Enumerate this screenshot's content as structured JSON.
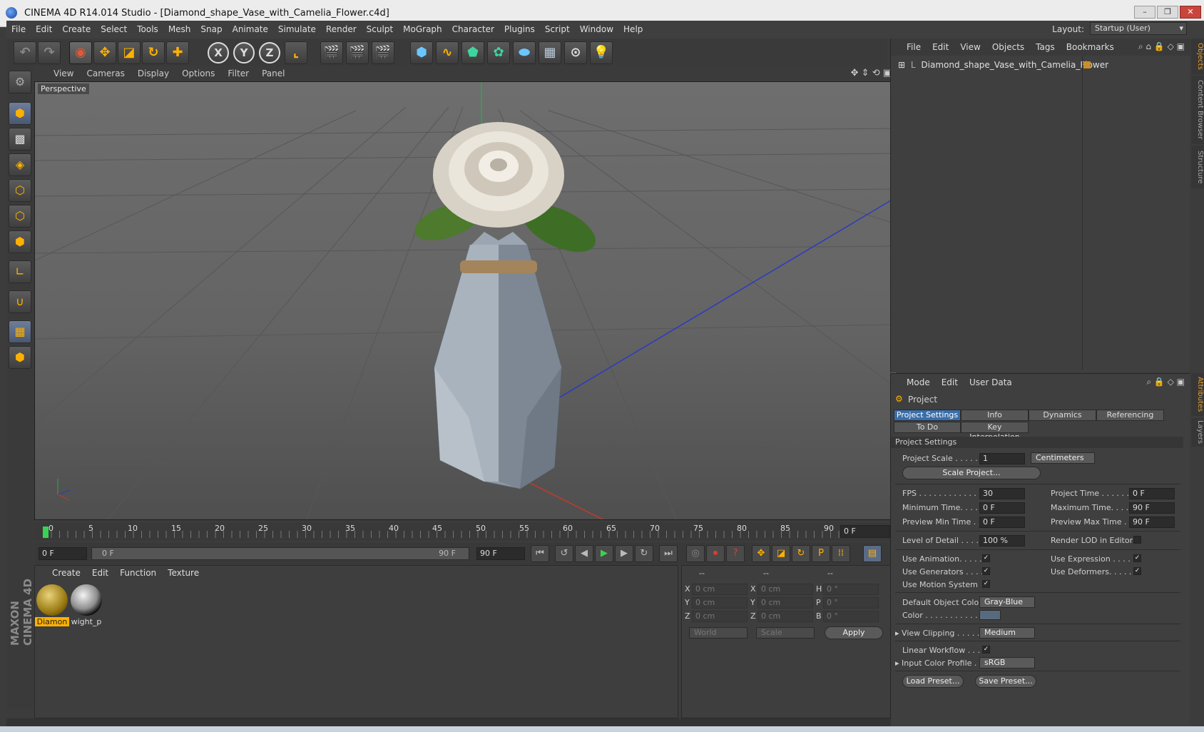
{
  "window": {
    "title": "CINEMA 4D R14.014 Studio - [Diamond_shape_Vase_with_Camelia_Flower.c4d]"
  },
  "menubar": [
    "File",
    "Edit",
    "Create",
    "Select",
    "Tools",
    "Mesh",
    "Snap",
    "Animate",
    "Simulate",
    "Render",
    "Sculpt",
    "MoGraph",
    "Character",
    "Plugins",
    "Script",
    "Window",
    "Help"
  ],
  "layout": {
    "label": "Layout:",
    "value": "Startup (User)"
  },
  "viewport": {
    "menus": [
      "View",
      "Cameras",
      "Display",
      "Options",
      "Filter",
      "Panel"
    ],
    "label": "Perspective"
  },
  "timeline": {
    "ticks": [
      "0",
      "5",
      "10",
      "15",
      "20",
      "25",
      "30",
      "35",
      "40",
      "45",
      "50",
      "55",
      "60",
      "65",
      "70",
      "75",
      "80",
      "85",
      "90"
    ],
    "current_frame": "0 F"
  },
  "transport": {
    "start": "0 F",
    "range_start": "0 F",
    "range_end": "90 F",
    "end": "90 F"
  },
  "materials": {
    "menus": [
      "Create",
      "Edit",
      "Function",
      "Texture"
    ],
    "items": [
      {
        "label": "Diamon"
      },
      {
        "label": "wight_p"
      }
    ]
  },
  "coordinates": {
    "headers": [
      "--",
      "--",
      "--"
    ],
    "rows": [
      {
        "a": "X",
        "av": "0 cm",
        "b": "X",
        "bv": "0 cm",
        "c": "H",
        "cv": "0 °"
      },
      {
        "a": "Y",
        "av": "0 cm",
        "b": "Y",
        "bv": "0 cm",
        "c": "P",
        "cv": "0 °"
      },
      {
        "a": "Z",
        "av": "0 cm",
        "b": "Z",
        "bv": "0 cm",
        "c": "B",
        "cv": "0 °"
      }
    ],
    "world": "World",
    "scale": "Scale",
    "apply": "Apply"
  },
  "objects": {
    "menus": [
      "File",
      "Edit",
      "View",
      "Objects",
      "Tags",
      "Bookmarks"
    ],
    "item": "Diamond_shape_Vase_with_Camelia_Flower"
  },
  "attributes": {
    "menus": [
      "Mode",
      "Edit",
      "User Data"
    ],
    "heading": "Project",
    "tabs_row1": [
      "Project Settings",
      "Info",
      "Dynamics",
      "Referencing"
    ],
    "tabs_row2": [
      "To Do",
      "Key Interpolation"
    ],
    "section": "Project Settings",
    "project_scale_label": "Project Scale . . . . . .",
    "project_scale_value": "1",
    "project_scale_unit": "Centimeters",
    "scale_project_btn": "Scale Project...",
    "fps_label": "FPS . . . . . . . . . . . . . .",
    "fps_value": "30",
    "project_time_label": "Project Time . . . . . . . .",
    "project_time_value": "0 F",
    "min_time_label": "Minimum Time. . . . .",
    "min_time_value": "0 F",
    "max_time_label": "Maximum Time. . . . . .",
    "max_time_value": "90 F",
    "prev_min_label": "Preview Min Time . . .",
    "prev_min_value": "0 F",
    "prev_max_label": "Preview Max Time . . .",
    "prev_max_value": "90 F",
    "lod_label": "Level of Detail . . . . . .",
    "lod_value": "100 %",
    "render_lod_label": "Render LOD in Editor",
    "use_animation": "Use Animation. . . . .",
    "use_expression": "Use Expression . . . . .",
    "use_generators": "Use Generators . . . .",
    "use_deformers": "Use Deformers. . . . . .",
    "use_motion": "Use Motion System",
    "default_color_label": "Default Object Color",
    "default_color_value": "Gray-Blue",
    "color_label": "Color . . . . . . . . . . .",
    "view_clipping_label": "View Clipping . . . . .",
    "view_clipping_value": "Medium",
    "linear_workflow_label": "Linear Workflow . . .",
    "input_profile_label": "Input Color Profile . .",
    "input_profile_value": "sRGB",
    "load_preset": "Load Preset...",
    "save_preset": "Save Preset..."
  },
  "side_tabs": [
    "Objects",
    "Content Browser",
    "Structure",
    "Attributes",
    "Layers"
  ],
  "branding": "MAXON CINEMA 4D",
  "colors": {
    "accent": "#ffb100",
    "selection": "#3b6ea8",
    "object_color": "#586a7e"
  }
}
